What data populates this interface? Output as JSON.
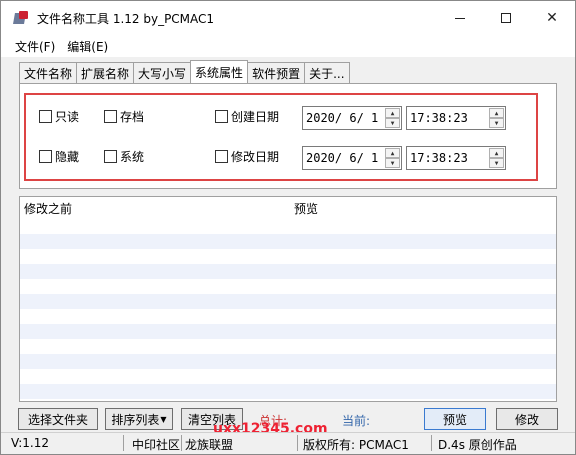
{
  "window": {
    "title": "文件名称工具 1.12   by_PCMAC1",
    "minimize": "–",
    "maximize": "□",
    "close": "✕"
  },
  "menu": [
    "文件(F)",
    "编辑(E)"
  ],
  "tabs": [
    "文件名称",
    "扩展名称",
    "大写小写",
    "系统属性",
    "软件预置",
    "关于..."
  ],
  "attributes": {
    "readonly": "只读",
    "archive": "存档",
    "hidden": "隐藏",
    "system": "系统",
    "created_label": "创建日期",
    "modified_label": "修改日期",
    "created_date": "2020/ 6/ 1",
    "created_time": "17:38:23",
    "modified_date": "2020/ 6/ 1",
    "modified_time": "17:38:23"
  },
  "list": {
    "col_before": "修改之前",
    "col_preview": "预览"
  },
  "buttons": {
    "select_files": "选择文件夹",
    "sort_list": "排序列表",
    "clear_list": "清空列表",
    "preview": "预览",
    "modify": "修改"
  },
  "labels": {
    "total": "总计:",
    "current": "当前:"
  },
  "status": {
    "version": "V:1.12",
    "community": "中印社区",
    "alliance": "龙族联盟",
    "copyright": "版权所有: PCMAC1",
    "original": "D.4s 原创作品"
  },
  "watermark": "uxx12345.com",
  "colors": {
    "accent_red": "#dd4444",
    "label_red": "#cc3333",
    "label_blue": "#3366aa"
  }
}
